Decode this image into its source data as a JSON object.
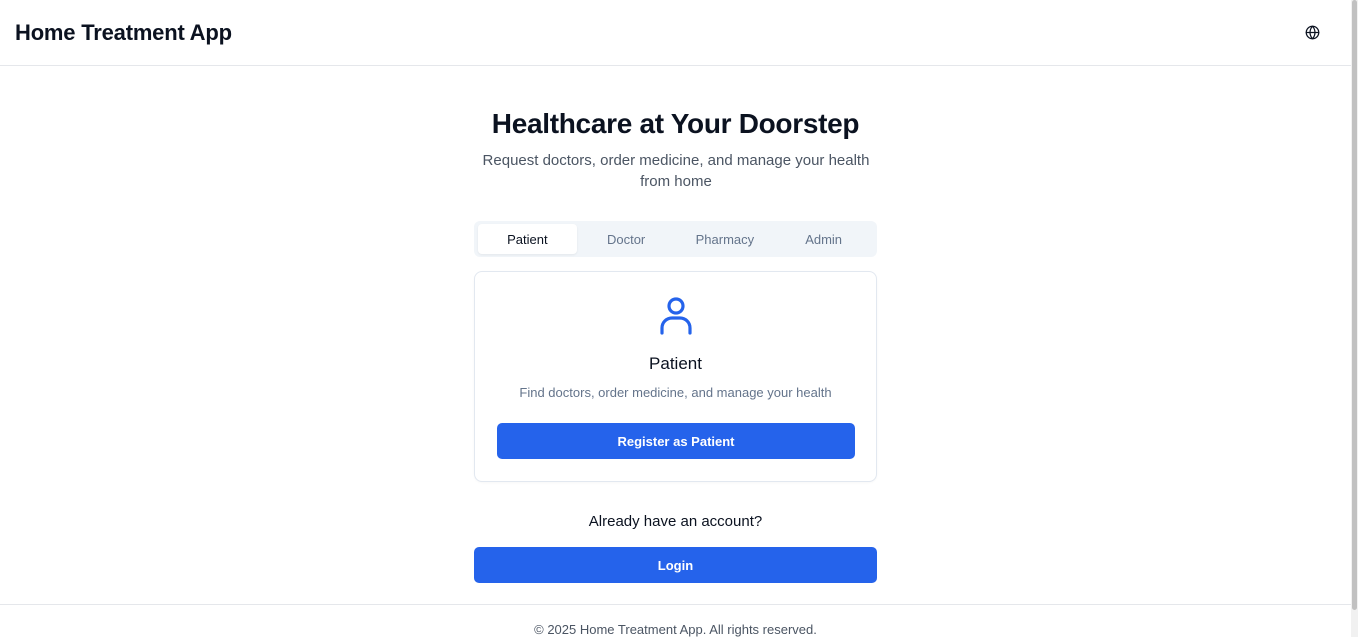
{
  "header": {
    "app_title": "Home Treatment App",
    "language_icon": "globe-icon"
  },
  "hero": {
    "title": "Healthcare at Your Doorstep",
    "subtitle": "Request doctors, order medicine, and manage your health from home"
  },
  "tabs": [
    {
      "label": "Patient",
      "active": true
    },
    {
      "label": "Doctor",
      "active": false
    },
    {
      "label": "Pharmacy",
      "active": false
    },
    {
      "label": "Admin",
      "active": false
    }
  ],
  "role_card": {
    "icon": "user-icon",
    "title": "Patient",
    "description": "Find doctors, order medicine, and manage your health",
    "register_label": "Register as Patient"
  },
  "login_section": {
    "prompt": "Already have an account?",
    "login_label": "Login"
  },
  "footer": {
    "copyright": "© 2025 Home Treatment App. All rights reserved."
  },
  "colors": {
    "accent": "#2563eb",
    "text": "#0b1220",
    "muted": "#64748b"
  }
}
